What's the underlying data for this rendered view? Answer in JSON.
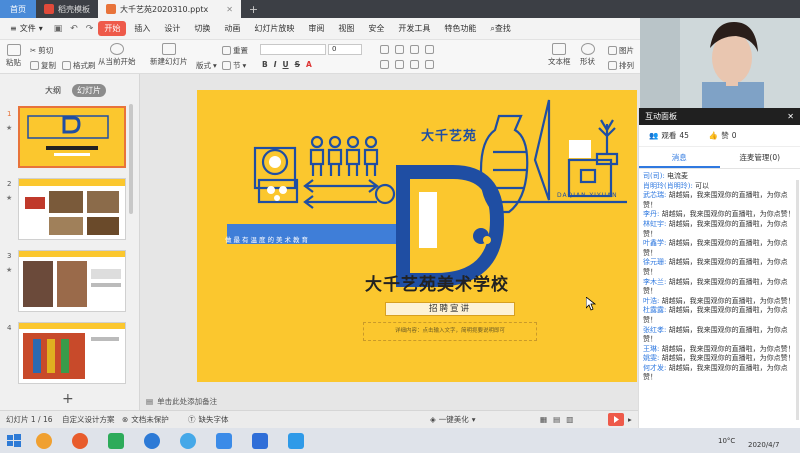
{
  "tabs": [
    {
      "label": "首页"
    },
    {
      "label": "稻壳模板"
    },
    {
      "label": "大千艺苑2020310.pptx"
    },
    {
      "label": "+"
    }
  ],
  "menu": {
    "file": "文件",
    "items": [
      "开始",
      "插入",
      "设计",
      "切换",
      "动画",
      "幻灯片放映",
      "审阅",
      "视图",
      "安全",
      "开发工具",
      "特色功能"
    ],
    "search": "查找"
  },
  "toolbar": {
    "paste": "粘贴",
    "cut": "剪切",
    "copy": "复制",
    "format_painter": "格式刷",
    "play_from_current": "从当前开始",
    "new_slide": "新建幻灯片",
    "layout": "版式",
    "section": "节",
    "reset": "重置",
    "font_size": "0",
    "textbox": "文本框",
    "shape": "形状",
    "picture": "图片",
    "arrange": "排列"
  },
  "leftpane": {
    "tab_outline": "大纲",
    "tab_slides": "幻灯片",
    "slide_numbers": [
      "1",
      "2",
      "3",
      "4"
    ],
    "add": "+"
  },
  "slide": {
    "brand": "大千艺苑",
    "brand_en": "DAQIAN YIYUAN",
    "slogan": "做最有温度的美术教育",
    "title": "大千艺苑美术学校",
    "subtitle": "招聘宣讲",
    "detail": "详细内容：点击输入文字，简明扼要说明即可"
  },
  "notes_placeholder": "单击此处添加备注",
  "statusbar": {
    "slide_count": "幻灯片 1 / 16",
    "design": "自定义设计方案",
    "doc_protect": "文档未保护",
    "missing_font": "缺失字体",
    "beautify": "一键美化"
  },
  "panel": {
    "title": "互动面板",
    "viewers_label": "观看",
    "viewers_count": "45",
    "likes_label": "赞",
    "likes_count": "0",
    "tab_messages": "消息",
    "tab_connect": "连麦管理(0)",
    "messages": [
      {
        "name": "司(司):",
        "text": " 电流麦"
      },
      {
        "name": "肖明玲(肖明玲):",
        "text": " 可以"
      },
      {
        "name": "武芯瑞:",
        "text": " 胡越娟，我来围观你的直播啦，为你点赞！"
      },
      {
        "name": "李丹:",
        "text": " 胡越娟，我来围观你的直播啦，为你点赞！"
      },
      {
        "name": "林虹宇:",
        "text": " 胡越娟，我来围观你的直播啦，为你点赞！"
      },
      {
        "name": "叶鑫学:",
        "text": " 胡越娟，我来围观你的直播啦，为你点赞！"
      },
      {
        "name": "徐元珊:",
        "text": " 胡越娟，我来围观你的直播啦，为你点赞！"
      },
      {
        "name": "李木兰:",
        "text": " 胡越娟，我来围观你的直播啦，为你点赞！"
      },
      {
        "name": "叶浩:",
        "text": " 胡越娟，我来围观你的直播啦，为你点赞！"
      },
      {
        "name": "杜露露:",
        "text": " 胡越娟，我来围观你的直播啦，为你点赞！"
      },
      {
        "name": "张红孝:",
        "text": " 胡越娟，我来围观你的直播啦，为你点赞！"
      },
      {
        "name": "王琳:",
        "text": " 胡越娟，我来围观你的直播啦，为你点赞！"
      },
      {
        "name": "姚雯:",
        "text": " 胡越娟，我来围观你的直播啦，为你点赞！"
      },
      {
        "name": "何才发:",
        "text": " 胡越娟，我来围观你的直播啦，为你点赞！"
      }
    ]
  },
  "taskbar": {
    "temp": "10°C",
    "date": "2020/4/7"
  },
  "colors": {
    "accent": "#ee5a4a",
    "slide_bg": "#fbc72e",
    "brand_blue": "#1f4ea3",
    "link_blue": "#2f79e0"
  }
}
